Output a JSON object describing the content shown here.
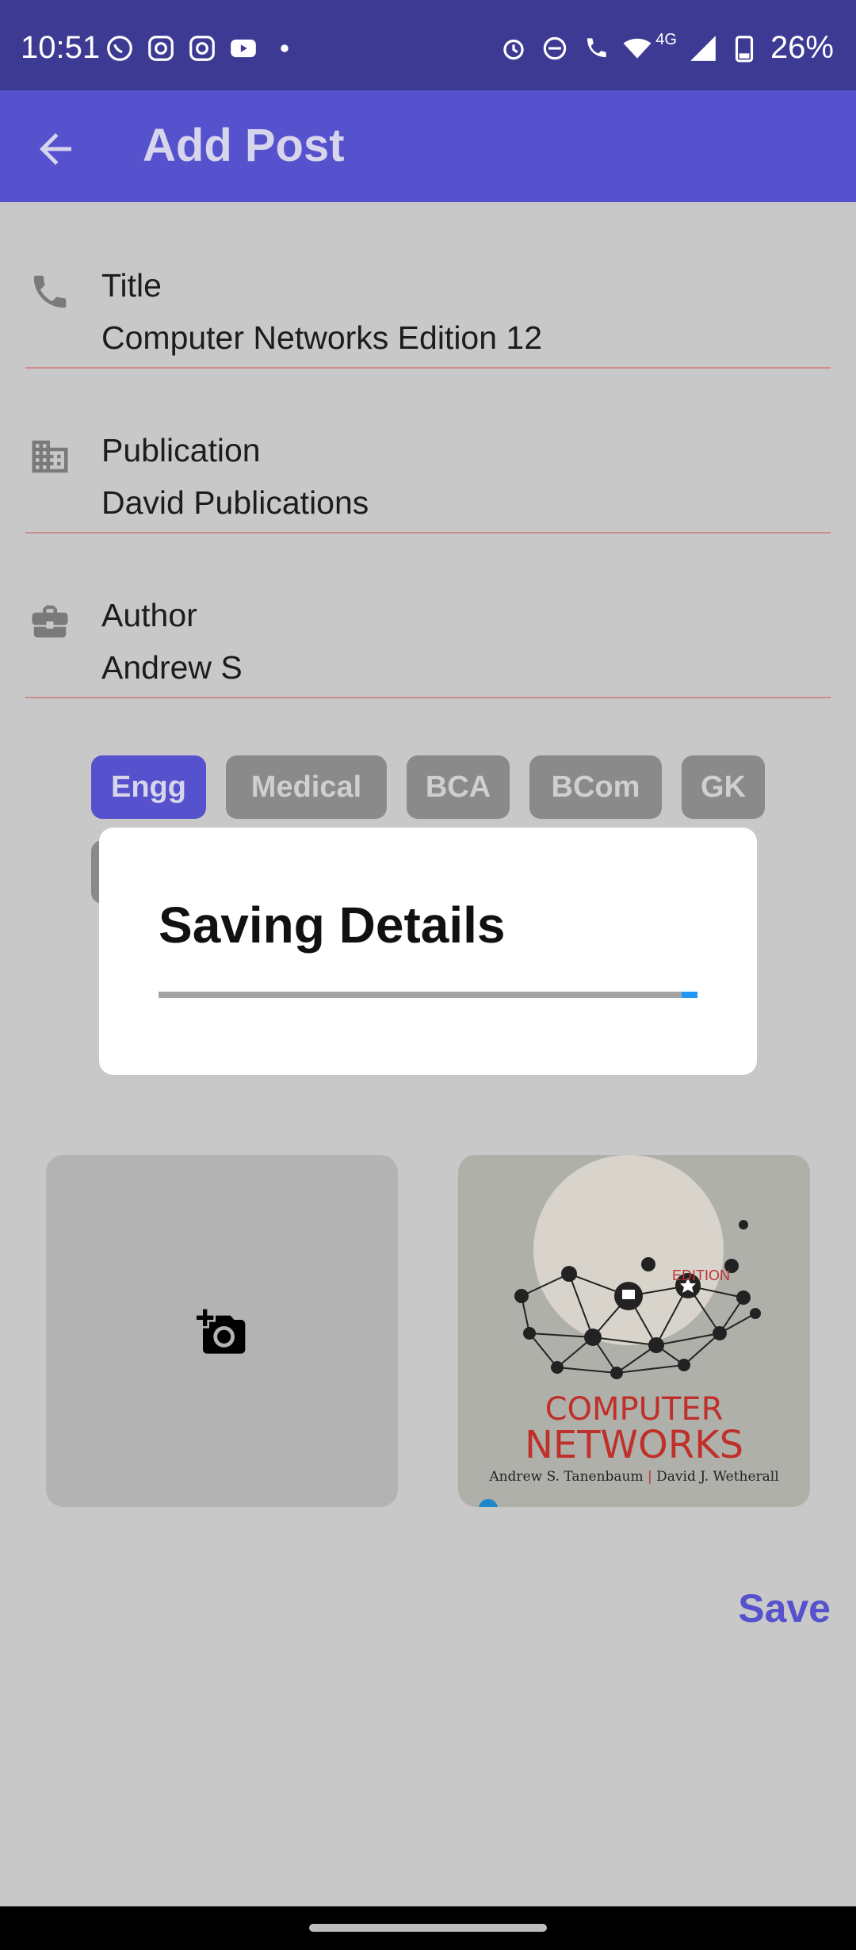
{
  "status_bar": {
    "time": "10:51",
    "battery": "26%",
    "network": "4G",
    "left_icons": [
      "whatsapp-icon",
      "instagram-icon",
      "instagram-icon",
      "youtube-icon",
      "dot-icon"
    ],
    "right_icons": [
      "alarm-icon",
      "dnd-icon",
      "wifi-call-icon",
      "wifi-icon",
      "signal-icon",
      "battery-icon"
    ]
  },
  "app_bar": {
    "title": "Add Post",
    "back_icon": "arrow-back-icon"
  },
  "fields": [
    {
      "label": "Title",
      "value": "Computer Networks Edition 12",
      "icon": "phone-icon"
    },
    {
      "label": "Publication",
      "value": "David Publications",
      "icon": "building-icon"
    },
    {
      "label": "Author",
      "value": "Andrew S",
      "icon": "briefcase-icon"
    }
  ],
  "chips": [
    {
      "label": "Engg",
      "selected": true
    },
    {
      "label": "Medical",
      "selected": false
    },
    {
      "label": "BCA",
      "selected": false
    },
    {
      "label": "BCom",
      "selected": false
    },
    {
      "label": "GK",
      "selected": false
    }
  ],
  "images": {
    "add_icon": "add-photo-icon",
    "cover": {
      "edition_text": "EDITION",
      "title_line1": "COMPUTER",
      "title_line2": "NETWORKS",
      "author1": "Andrew S. Tanenbaum",
      "author2": "David J. Wetherall"
    }
  },
  "save_label": "Save",
  "dialog": {
    "title": "Saving Details",
    "progress_percent": 3
  },
  "colors": {
    "accent": "#5651cc",
    "status_bar": "#3d3a94",
    "progress": "#2196f3"
  }
}
